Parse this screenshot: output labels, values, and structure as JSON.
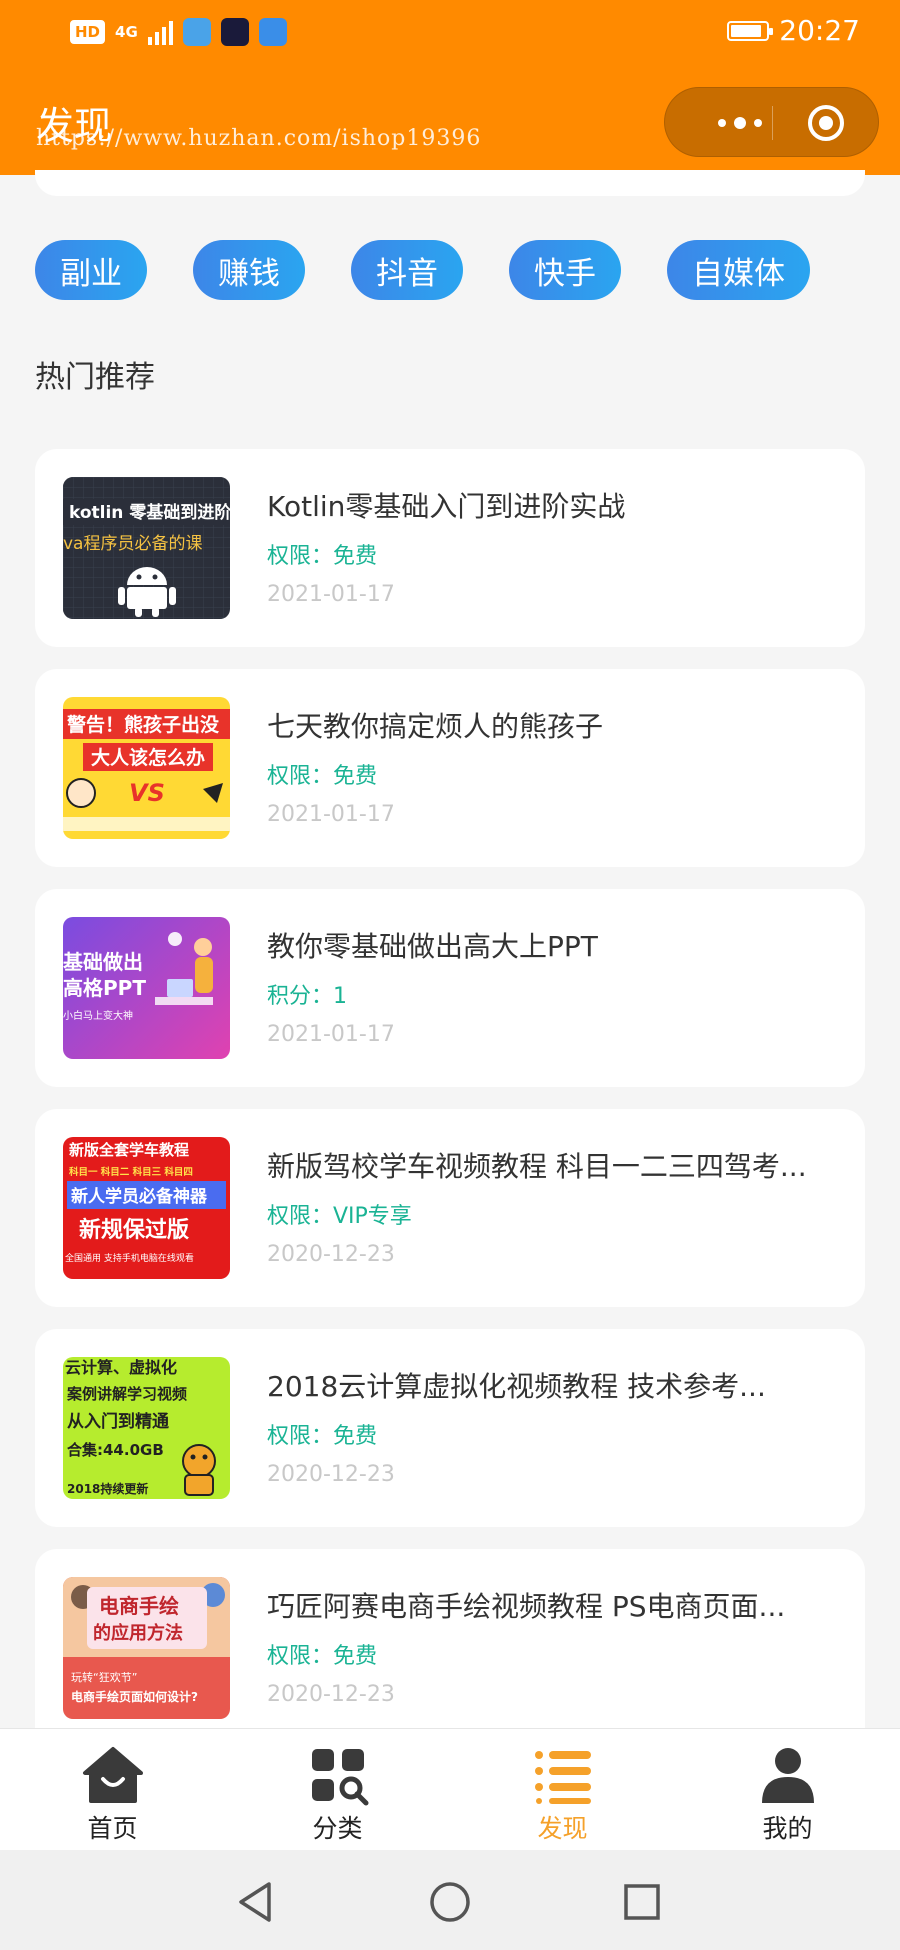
{
  "status": {
    "hd": "HD",
    "network": "4G",
    "time": "20:27"
  },
  "header": {
    "title": "发现",
    "watermark": "https://www.huzhan.com/ishop19396"
  },
  "colors": {
    "header": "#ff8a00",
    "tag_start": "#3d86e8",
    "tag_end": "#2aa5f0",
    "permission": "#1ab394",
    "tab_active": "#f5a12a"
  },
  "tags": [
    "副业",
    "赚钱",
    "抖音",
    "快手",
    "自媒体"
  ],
  "section_title": "热门推荐",
  "items": [
    {
      "title": "Kotlin零基础入门到进阶实战",
      "permission": "权限：免费",
      "date": "2021-01-17",
      "thumb_text": [
        "kotlin 零基础到进阶",
        "va程序员必备的课"
      ]
    },
    {
      "title": "七天教你搞定烦人的熊孩子",
      "permission": "权限：免费",
      "date": "2021-01-17",
      "thumb_text": [
        "警告！熊孩子出没",
        "大人该怎么办",
        "VS"
      ]
    },
    {
      "title": "教你零基础做出高大上PPT",
      "permission": "积分：1",
      "date": "2021-01-17",
      "thumb_text": [
        "基础做出",
        "高格PPT",
        "小白马上变大神"
      ]
    },
    {
      "title": "新版驾校学车视频教程 科目一二三四驾考...",
      "permission": "权限：VIP专享",
      "date": "2020-12-23",
      "thumb_text": [
        "新版全套学车教程",
        "科目一 科目二 科目三 科目四",
        "新人学员必备神器",
        "新规保过版",
        "全国通用 支持手机电脑在线观看"
      ]
    },
    {
      "title": "2018云计算虚拟化视频教程 技术参考...",
      "permission": "权限：免费",
      "date": "2020-12-23",
      "thumb_text": [
        "云计算、虚拟化",
        "案例讲解学习视频",
        "从入门到精通",
        "合集:44.0GB",
        "2018持续更新"
      ]
    },
    {
      "title": "巧匠阿赛电商手绘视频教程 PS电商页面...",
      "permission": "权限：免费",
      "date": "2020-12-23",
      "thumb_text": [
        "电商手绘",
        "的应用方法",
        "玩转“狂欢节”",
        "电商手绘页面如何设计?"
      ]
    }
  ],
  "tabbar": [
    {
      "label": "首页",
      "icon": "home-icon",
      "active": false
    },
    {
      "label": "分类",
      "icon": "category-icon",
      "active": false
    },
    {
      "label": "发现",
      "icon": "discover-list-icon",
      "active": true
    },
    {
      "label": "我的",
      "icon": "user-icon",
      "active": false
    }
  ]
}
